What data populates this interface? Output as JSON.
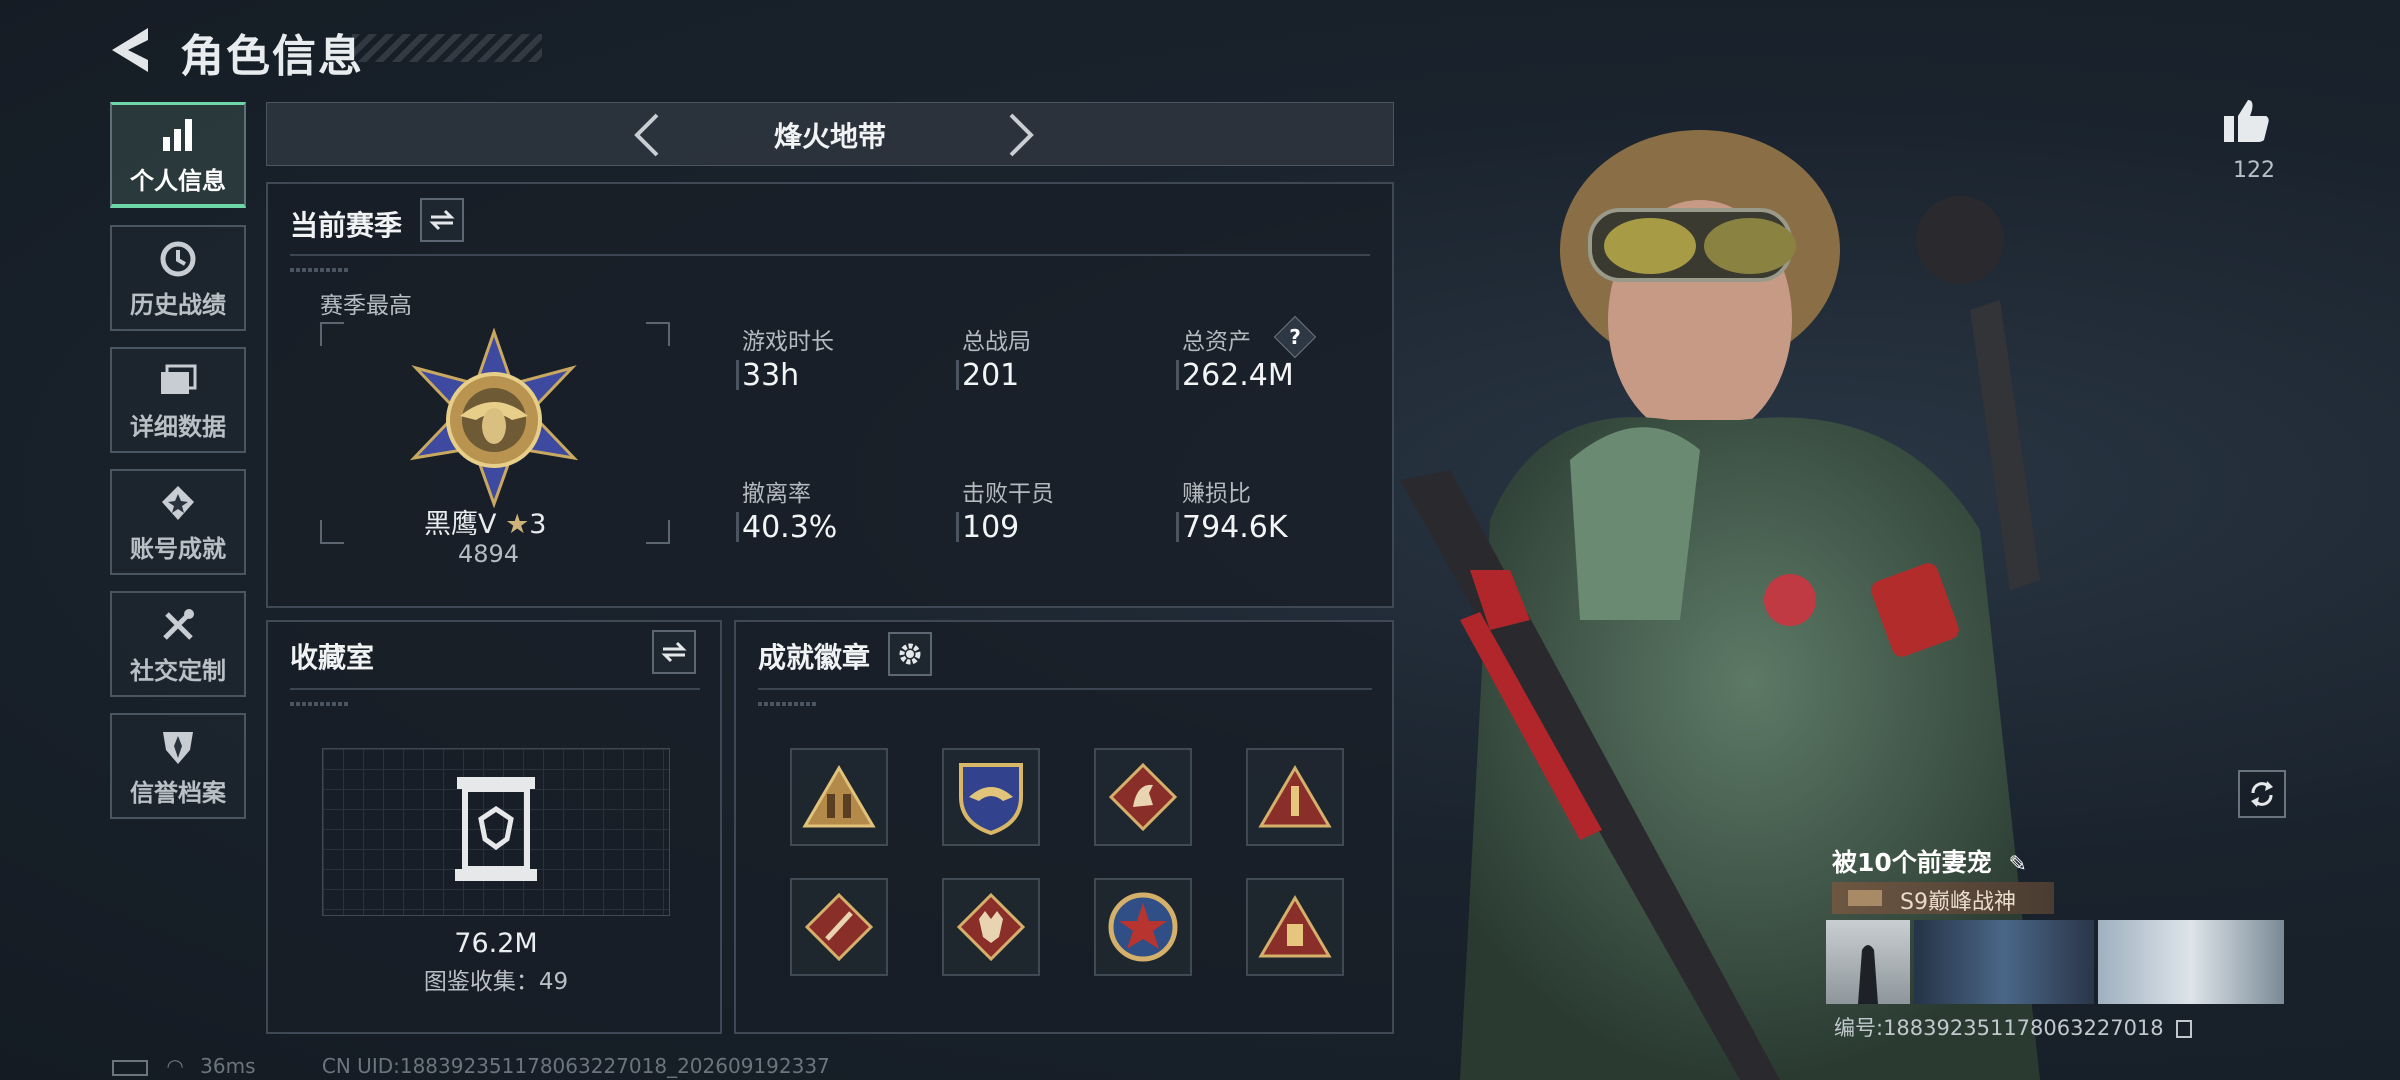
{
  "header": {
    "title": "角色信息"
  },
  "sidebar": {
    "items": [
      {
        "label": "个人信息",
        "icon": "bar-chart-icon",
        "active": true
      },
      {
        "label": "历史战绩",
        "icon": "history-icon"
      },
      {
        "label": "详细数据",
        "icon": "folder-icon"
      },
      {
        "label": "账号成就",
        "icon": "achievement-icon"
      },
      {
        "label": "社交定制",
        "icon": "tools-icon"
      },
      {
        "label": "信誉档案",
        "icon": "shield-icon"
      }
    ]
  },
  "mode": {
    "name": "烽火地带"
  },
  "season": {
    "title": "当前赛季",
    "best_label": "赛季最高",
    "rank_name": "黑鹰V",
    "rank_stars": "3",
    "rank_points": "4894",
    "stats": [
      {
        "label": "游戏时长",
        "value": "33h"
      },
      {
        "label": "总战局",
        "value": "201"
      },
      {
        "label": "总资产",
        "value": "262.4M",
        "help": "?"
      },
      {
        "label": "撤离率",
        "value": "40.3%"
      },
      {
        "label": "击败干员",
        "value": "109"
      },
      {
        "label": "赚损比",
        "value": "794.6K"
      }
    ]
  },
  "collection": {
    "title": "收藏室",
    "value": "76.2M",
    "catalog": "图鉴收集：49"
  },
  "achievements": {
    "title": "成就徽章",
    "badges": [
      "soldiers-badge-icon",
      "eagle-shield-badge-icon",
      "horse-badge-icon",
      "rocket-badge-icon",
      "knife-badge-icon",
      "wolf-badge-icon",
      "star-medal-badge-icon",
      "tank-badge-icon"
    ]
  },
  "profile": {
    "likes": "122",
    "nickname": "被10个前妻宠",
    "title_tag": "S9巅峰战神",
    "uid": "编号:188392351178063227018"
  },
  "footer": {
    "ping": "36ms",
    "uid": "CN UID:188392351178063227018_202609192337"
  },
  "colors": {
    "accent": "#6fd6a8",
    "panel_border": "#3e4955",
    "gold": "#d4b06a",
    "badge_red": "#8a2e2a"
  }
}
